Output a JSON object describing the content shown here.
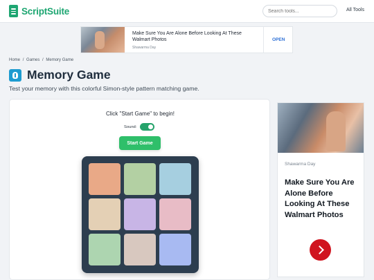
{
  "header": {
    "brand": "ScriptSuite",
    "search_placeholder": "Search tools...",
    "all_tools": "All Tools"
  },
  "ad_banner": {
    "headline": "Make Sure You Are Alone Before Looking At These Walmart Photos",
    "source": "Shawarma Day",
    "cta": "OPEN"
  },
  "breadcrumb": {
    "items": [
      "Home",
      "Games",
      "Memory Game"
    ],
    "separator": "/"
  },
  "page": {
    "title": "Memory Game",
    "subtitle": "Test your memory with this colorful Simon-style pattern matching game."
  },
  "game": {
    "status": "Click \"Start Game\" to begin!",
    "sound_label": "Sound:",
    "sound_on": true,
    "start_label": "Start Game",
    "board_color": "#2d3e4f",
    "tile_colors": [
      "#e9a987",
      "#b3d0a3",
      "#a6cfe0",
      "#e4d0b5",
      "#c8b5e6",
      "#e8bcc6",
      "#add5b0",
      "#d8c8bf",
      "#a8baf2"
    ]
  },
  "ad_side": {
    "source": "Shawarma Day",
    "headline": "Make Sure You Are Alone Before Looking At These Walmart Photos"
  },
  "colors": {
    "brand": "#1ea672",
    "start_button": "#2fbf6a",
    "ad_cta": "#d0141f"
  }
}
